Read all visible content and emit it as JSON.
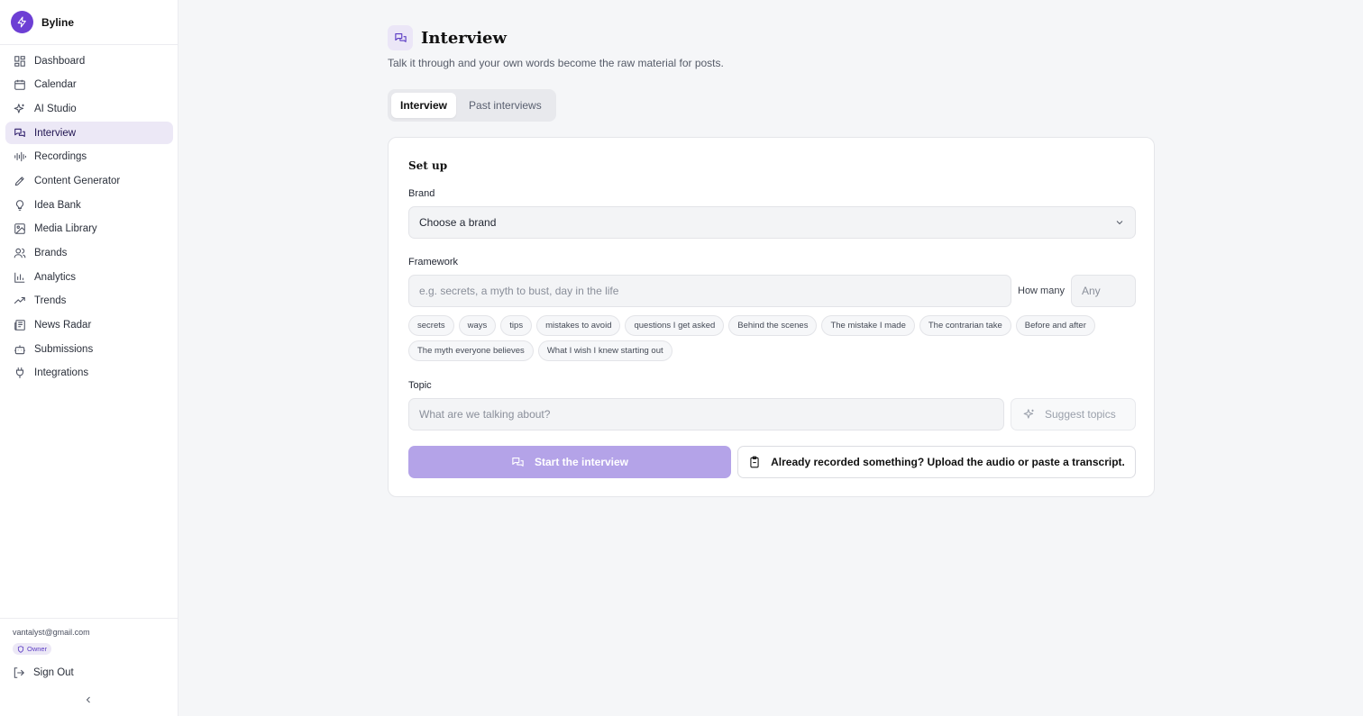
{
  "app": {
    "name": "Byline",
    "accent": "#6d3fd4"
  },
  "sidebar": {
    "items": [
      {
        "label": "Dashboard",
        "icon": "dashboard-icon",
        "active": false
      },
      {
        "label": "Calendar",
        "icon": "calendar-icon",
        "active": false
      },
      {
        "label": "AI Studio",
        "icon": "sparkles-icon",
        "active": false
      },
      {
        "label": "Interview",
        "icon": "chat-icon",
        "active": true
      },
      {
        "label": "Recordings",
        "icon": "waveform-icon",
        "active": false
      },
      {
        "label": "Content Generator",
        "icon": "pen-icon",
        "active": false
      },
      {
        "label": "Idea Bank",
        "icon": "lightbulb-icon",
        "active": false
      },
      {
        "label": "Media Library",
        "icon": "image-icon",
        "active": false
      },
      {
        "label": "Brands",
        "icon": "users-icon",
        "active": false
      },
      {
        "label": "Analytics",
        "icon": "bar-chart-icon",
        "active": false
      },
      {
        "label": "Trends",
        "icon": "trending-icon",
        "active": false
      },
      {
        "label": "News Radar",
        "icon": "newspaper-icon",
        "active": false
      },
      {
        "label": "Submissions",
        "icon": "robot-icon",
        "active": false
      },
      {
        "label": "Integrations",
        "icon": "plug-icon",
        "active": false
      }
    ],
    "user": {
      "email": "vantalyst@gmail.com",
      "role": "Owner"
    },
    "sign_out": "Sign Out"
  },
  "page": {
    "title": "Interview",
    "subtitle": "Talk it through and your own words become the raw material for posts.",
    "tabs": [
      {
        "label": "Interview",
        "active": true
      },
      {
        "label": "Past interviews",
        "active": false
      }
    ]
  },
  "setup": {
    "title": "Set up",
    "brand_label": "Brand",
    "brand_value": "Choose a brand",
    "framework_label": "Framework",
    "framework_placeholder": "e.g. secrets, a myth to bust, day in the life",
    "how_many_label": "How many",
    "how_many_placeholder": "Any",
    "chip_rows": [
      [
        "secrets",
        "ways",
        "tips",
        "mistakes to avoid",
        "questions I get asked",
        "Behind the scenes",
        "The mistake I made",
        "The contrarian take",
        "Before and after"
      ],
      [
        "The myth everyone believes",
        "What I wish I knew starting out"
      ]
    ],
    "topic_label": "Topic",
    "topic_placeholder": "What are we talking about?",
    "suggest_label": "Suggest topics",
    "start_label": "Start the interview",
    "upload_label": "Already recorded something? Upload the audio or paste a transcript."
  }
}
